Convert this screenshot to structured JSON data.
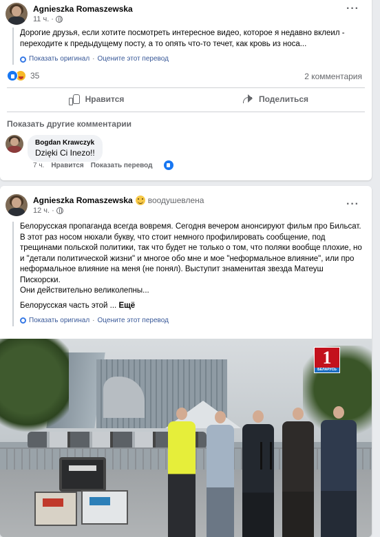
{
  "posts": [
    {
      "author": "Agnieszka Romaszewska",
      "time": "11 ч.",
      "text": "Дорогие друзья, если хотите посмотреть интересное видео, которое я недавно вклеил - переходите к предыдущему посту, а то опять что-то течет, как кровь из носа...",
      "show_original": "Показать оригинал",
      "rate_translation": "Оцените этот перевод",
      "reaction_count": "35",
      "comments_count": "2 комментария",
      "like_label": "Нравится",
      "share_label": "Поделиться",
      "more_comments": "Показать другие комментарии",
      "comment": {
        "author": "Bogdan Krawczyk",
        "text": "Dzięki Ci Inezo!!",
        "time": "7 ч.",
        "like": "Нравится",
        "show_translation": "Показать перевод"
      }
    },
    {
      "author": "Agnieszka Romaszewska",
      "feeling": "воодушевлена",
      "time": "12 ч.",
      "paragraph1": "Белорусская пропаганда всегда вовремя. Сегодня вечером анонсируют фильм про Бильсат. В этот раз носом нюхали букву, что стоит немного профилировать сообщение, под трещинами польской политики, так что будет не только о том, что поляки вообще плохие, но и \"детали политической жизни\" и многое обо мне и мое \"неформальное влияние\", или про неформальное влияние на меня (не понял). Выступит знаменитая звезда Матеуш Пискорски.",
      "paragraph2": "Они действительно великолепны...",
      "paragraph3": "Белорусская часть этой ...",
      "more": "Ещё",
      "show_original": "Показать оригинал",
      "rate_translation": "Оцените этот перевод",
      "logo_number": "1",
      "logo_caption": "БЕЛАРУСЬ"
    }
  ]
}
